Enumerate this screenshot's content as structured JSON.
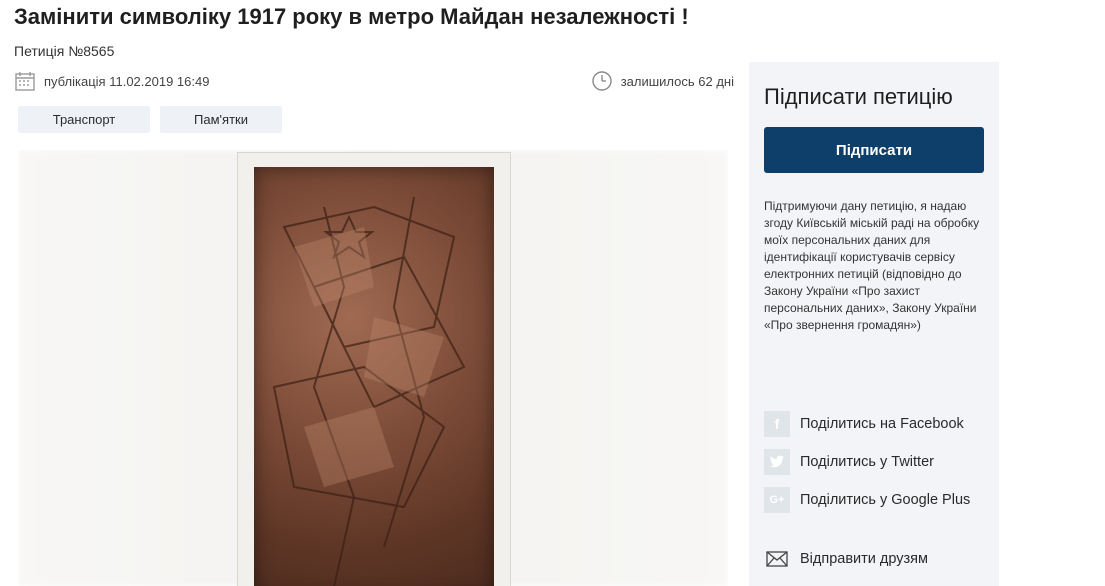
{
  "petition": {
    "title": "Замінити символіку 1917 року в метро Майдан незалежності !",
    "number": "Петиція №8565",
    "published": "публікація 11.02.2019 16:49",
    "remaining": "залишилось 62 дні",
    "tags": [
      "Транспорт",
      "Пам'ятки"
    ]
  },
  "icons": {
    "calendar": "calendar-icon",
    "clock": "clock-icon",
    "facebook": "facebook-icon",
    "twitter": "twitter-icon",
    "google_plus": "google-plus-icon",
    "mail": "mail-icon"
  },
  "sidebar": {
    "heading": "Підписати петицію",
    "sign_button": "Підписати",
    "consent": "Підтримуючи дану петицію, я надаю згоду Київській міській раді на обробку моїх персональних даних для ідентифікації користувачів сервісу електронних петицій (відповідно до Закону України «Про захист персональних даних», Закону України «Про звернення громадян»)",
    "share": {
      "facebook": "Поділитись на Facebook",
      "twitter": "Поділитись у Twitter",
      "google_plus": "Поділитись у Google Plus",
      "friends": "Відправити друзям"
    }
  },
  "colors": {
    "primary": "#0e3e6a",
    "sidebar_bg": "#f2f4f7",
    "tag_bg": "#eef2f7"
  }
}
